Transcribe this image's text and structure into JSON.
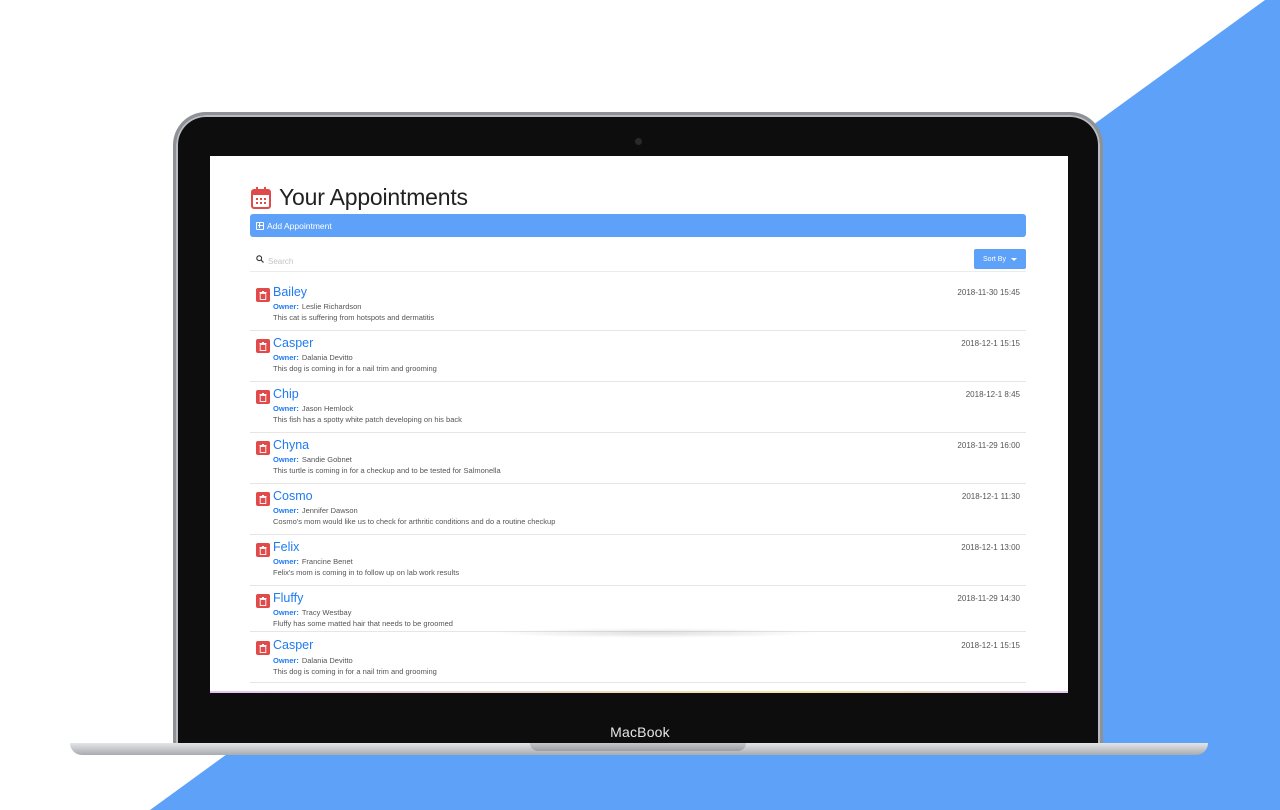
{
  "page": {
    "title": "Your Appointments",
    "add_button_label": "Add Appointment",
    "search_placeholder": "Search",
    "sort_button_label": "Sort By"
  },
  "device": {
    "brand_label": "MacBook"
  },
  "colors": {
    "accent": "#5da1f8",
    "link": "#1f7bf0",
    "danger": "#e14a4a",
    "title_icon": "#e14a4a"
  },
  "appointments": [
    {
      "pet": "Bailey",
      "owner_label": "Owner:",
      "owner": "Leslie Richardson",
      "notes": "This cat is suffering from hotspots and dermatitis",
      "date": "2018-11-30 15:45"
    },
    {
      "pet": "Casper",
      "owner_label": "Owner:",
      "owner": "Dalania Devitto",
      "notes": "This dog is coming in for a nail trim and grooming",
      "date": "2018-12-1 15:15"
    },
    {
      "pet": "Chip",
      "owner_label": "Owner:",
      "owner": "Jason Hemlock",
      "notes": "This fish has a spotty white patch developing on his back",
      "date": "2018-12-1 8:45"
    },
    {
      "pet": "Chyna",
      "owner_label": "Owner:",
      "owner": "Sandie Gobnet",
      "notes": "This turtle is coming in for a checkup and to be tested for Salmonella",
      "date": "2018-11-29 16:00"
    },
    {
      "pet": "Cosmo",
      "owner_label": "Owner:",
      "owner": "Jennifer Dawson",
      "notes": "Cosmo's mom would like us to check for arthritic conditions and do a routine checkup",
      "date": "2018-12-1 11:30"
    },
    {
      "pet": "Felix",
      "owner_label": "Owner:",
      "owner": "Francine Benet",
      "notes": "Felix's mom is coming in to follow up on lab work results",
      "date": "2018-12-1 13:00"
    },
    {
      "pet": "Fluffy",
      "owner_label": "Owner:",
      "owner": "Tracy Westbay",
      "notes": "Fluffy has some matted hair that needs to be groomed",
      "date": "2018-11-29 14:30"
    },
    {
      "pet": "Casper",
      "owner_label": "Owner:",
      "owner": "Dalania Devitto",
      "notes": "This dog is coming in for a nail trim and grooming",
      "date": "2018-12-1 15:15"
    }
  ]
}
